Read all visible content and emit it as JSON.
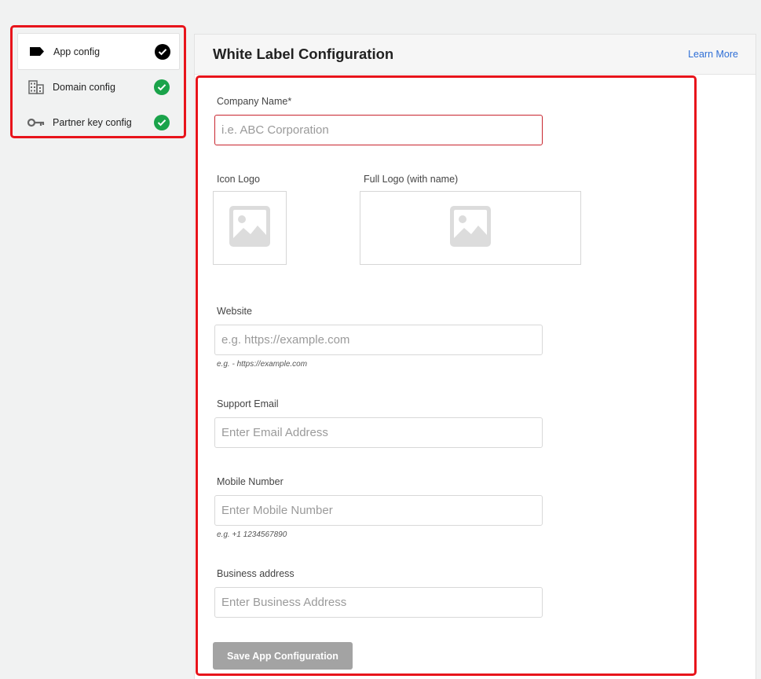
{
  "sidebar": {
    "items": [
      {
        "label": "App config",
        "icon": "label-tag-icon",
        "status": "check-black"
      },
      {
        "label": "Domain config",
        "icon": "building-icon",
        "status": "check-green"
      },
      {
        "label": "Partner key config",
        "icon": "key-icon",
        "status": "check-green"
      }
    ]
  },
  "header": {
    "title": "White Label Configuration",
    "learn_more": "Learn More"
  },
  "form": {
    "company_name": {
      "label": "Company Name*",
      "placeholder": "i.e. ABC Corporation",
      "value": ""
    },
    "icon_logo": {
      "label": "Icon Logo"
    },
    "full_logo": {
      "label": "Full Logo (with name)"
    },
    "website": {
      "label": "Website",
      "placeholder": "e.g. https://example.com",
      "value": "",
      "hint": "e.g. - https://example.com"
    },
    "support_email": {
      "label": "Support Email",
      "placeholder": "Enter Email Address",
      "value": ""
    },
    "mobile_number": {
      "label": "Mobile Number",
      "placeholder": "Enter Mobile Number",
      "value": "",
      "hint": "e.g. +1 1234567890"
    },
    "business_address": {
      "label": "Business address",
      "placeholder": "Enter Business Address",
      "value": ""
    },
    "save_label": "Save App Configuration"
  },
  "colors": {
    "highlight": "#e8141b",
    "check_green": "#1aa34a",
    "link": "#2f6fd6",
    "button_disabled": "#a3a3a3",
    "error_border": "#c8252e"
  }
}
